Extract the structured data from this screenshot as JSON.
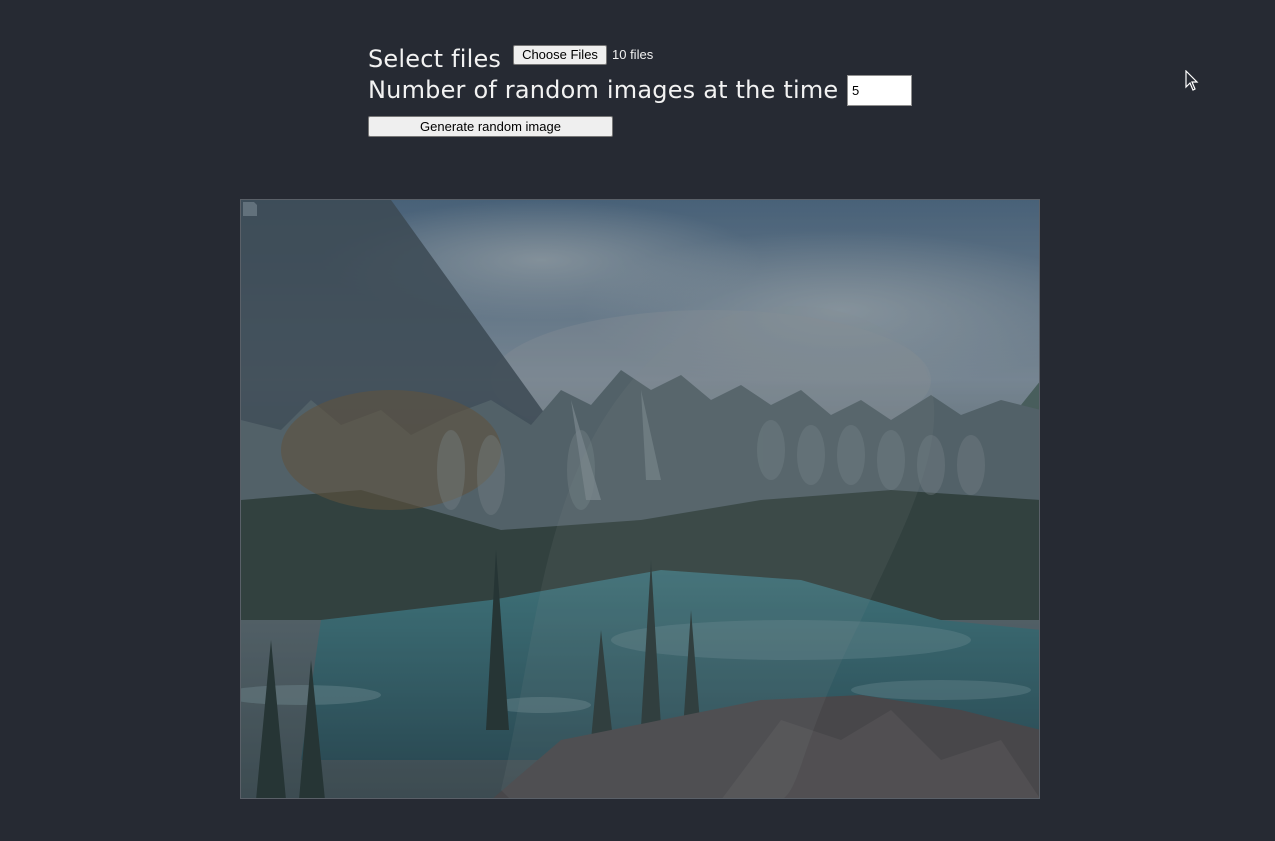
{
  "form": {
    "select_label": "Select files",
    "choose_files_label": "Choose Files",
    "file_status": "10 files",
    "count_label": "Number of random images at the time",
    "count_value": "5",
    "generate_label": "Generate random image"
  },
  "colors": {
    "background": "#262a33",
    "text": "#f2f2f2",
    "button_bg": "#efefef"
  },
  "icons": {
    "pointer": "mouse-cursor-icon",
    "broken_image": "broken-image-icon"
  }
}
